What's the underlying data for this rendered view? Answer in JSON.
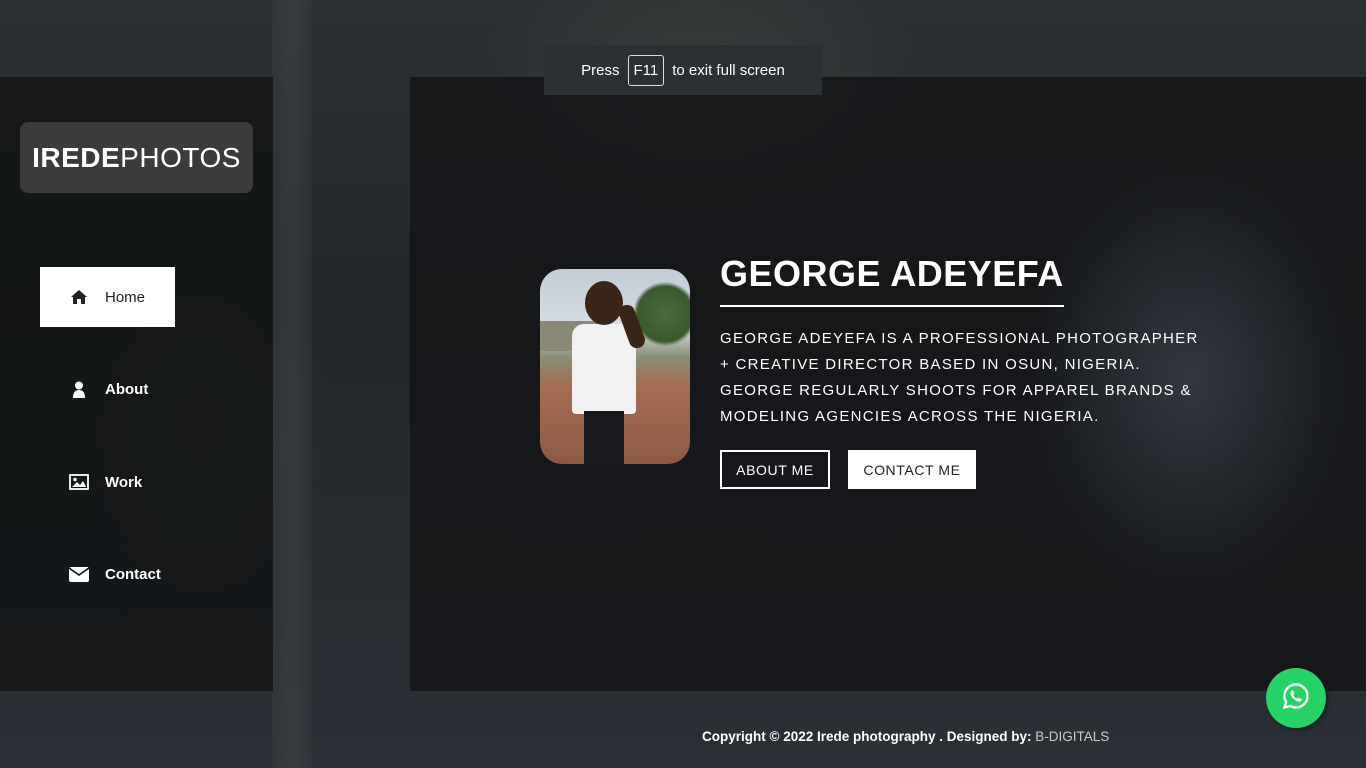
{
  "fullscreen_notice": {
    "prefix": "Press",
    "key": "F11",
    "suffix": "to exit full screen"
  },
  "logo": {
    "bold": "IREDE",
    "light": "PHOTOS"
  },
  "nav": {
    "items": [
      {
        "label": "Home",
        "icon": "home-icon",
        "active": true
      },
      {
        "label": "About",
        "icon": "user-icon",
        "active": false
      },
      {
        "label": "Work",
        "icon": "image-icon",
        "active": false
      },
      {
        "label": "Contact",
        "icon": "envelope-icon",
        "active": false
      }
    ]
  },
  "hero": {
    "name": "GEORGE ADEYEFA",
    "bio": "GEORGE ADEYEFA IS A PROFESSIONAL PHOTOGRAPHER + CREATIVE DIRECTOR BASED IN OSUN, NIGERIA. GEORGE REGULARLY SHOOTS FOR APPAREL BRANDS & MODELING AGENCIES ACROSS THE NIGERIA.",
    "about_button": "ABOUT ME",
    "contact_button": "CONTACT ME"
  },
  "footer": {
    "copyright": "Copyright © 2022 Irede photography . Designed by:",
    "designer": "B-DIGITALS"
  },
  "colors": {
    "whatsapp": "#25d366",
    "logo_bg": "#3b3b3b",
    "panel_bg": "#121416"
  }
}
